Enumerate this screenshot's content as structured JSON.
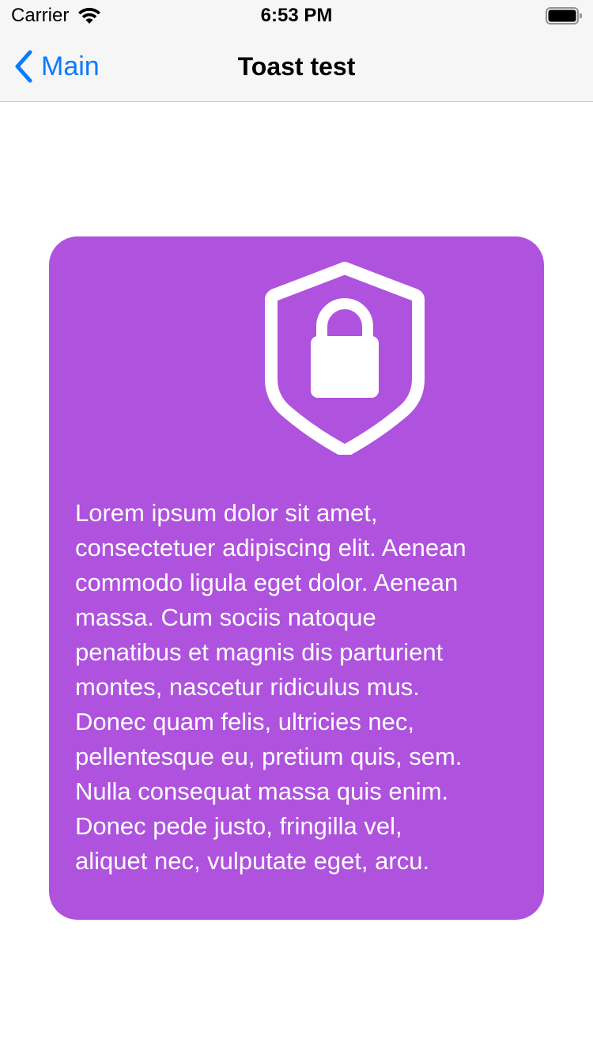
{
  "status_bar": {
    "carrier": "Carrier",
    "time": "6:53 PM",
    "wifi_icon": "wifi-icon",
    "battery_icon": "battery-icon"
  },
  "nav": {
    "back_label": "Main",
    "back_icon": "chevron-left-icon",
    "title": "Toast test",
    "accent_color": "#0a7aff"
  },
  "toast": {
    "background_color": "#af52de",
    "icon": "shield-lock-icon",
    "message": "Lorem ipsum dolor sit amet,\nconsectetuer adipiscing elit. Aenean\ncommodo ligula eget dolor. Aenean\nmassa. Cum sociis natoque\npenatibus et magnis dis parturient\nmontes, nascetur ridiculus mus.\nDonec quam felis, ultricies nec,\npellentesque eu, pretium quis, sem.\nNulla consequat massa quis enim.\nDonec pede justo, fringilla vel,\naliquet nec, vulputate eget, arcu."
  }
}
